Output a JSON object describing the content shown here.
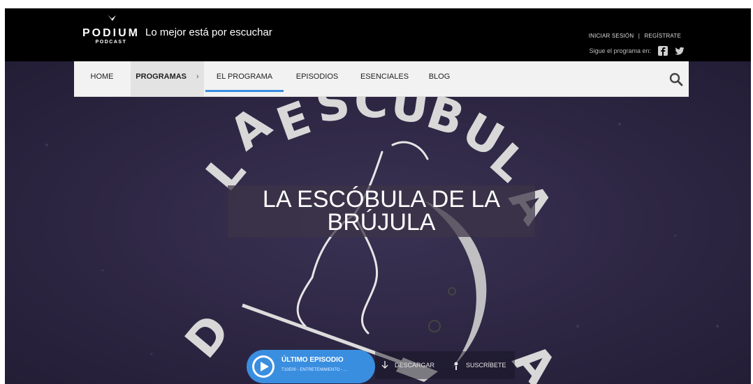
{
  "header": {
    "logo_main": "PODIUM",
    "logo_sub": "PODCAST",
    "tagline": "Lo mejor está por escuchar",
    "login": "INICIAR SESIÓN",
    "separator": "|",
    "register": "REGÍSTRATE",
    "follow_text": "Sigue el programa en:",
    "social_icons": [
      "facebook-icon",
      "twitter-icon"
    ]
  },
  "nav": {
    "items": [
      {
        "label": "HOME"
      },
      {
        "label": "PROGRAMAS"
      },
      {
        "label": "EL PROGRAMA"
      },
      {
        "label": "EPISODIOS"
      },
      {
        "label": "ESENCIALES"
      },
      {
        "label": "BLOG"
      }
    ],
    "breadcrumb_arrow": "›",
    "active": "EL PROGRAMA",
    "search_icon": "search-icon"
  },
  "hero": {
    "title_line1": "LA ESCÓBULA DE LA",
    "title_line2": "BRÚJULA"
  },
  "player": {
    "latest_label": "ÚLTIMO EPISODIO",
    "latest_sub": "T10E00 - ENTRETENIMIENTO - ...",
    "download_label": "DESCARGAR",
    "subscribe_label": "SUSCRÍBETE"
  },
  "colors": {
    "accent": "#3a8ee0",
    "header_bg": "#000000",
    "hero_bg": "#2b2440",
    "nav_bg": "#f2f2f2"
  }
}
